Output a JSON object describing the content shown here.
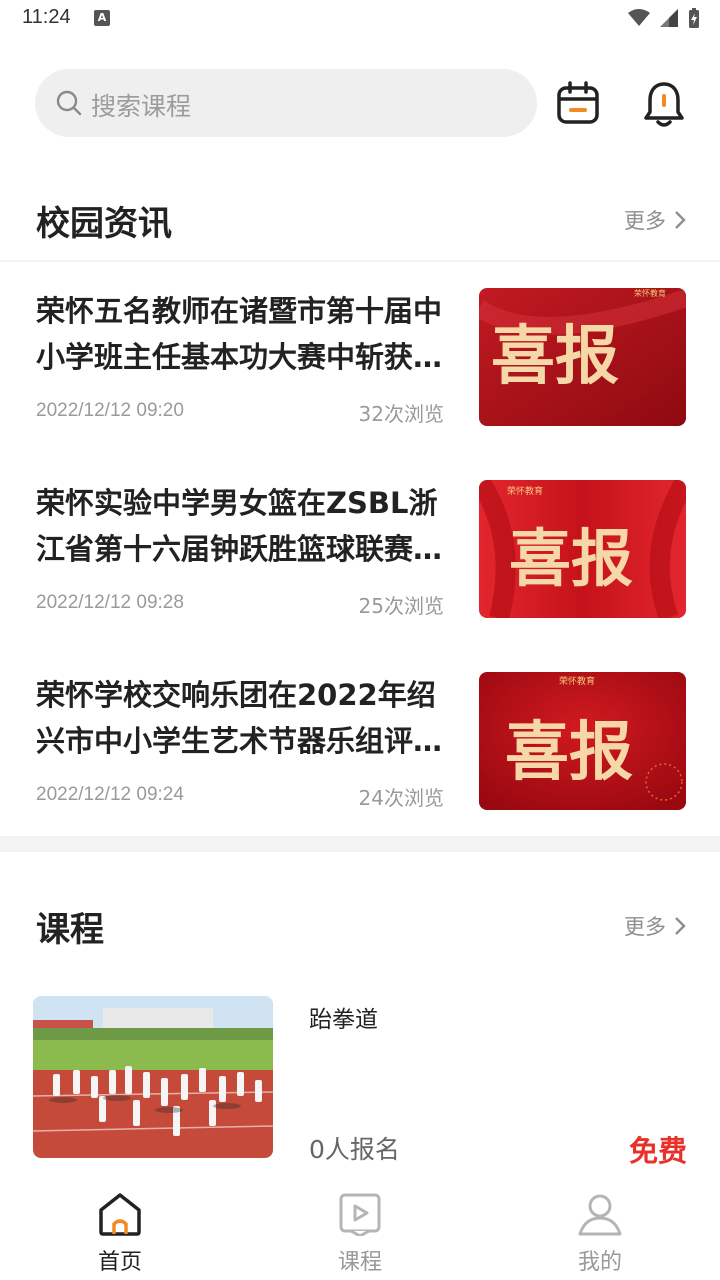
{
  "status": {
    "time": "11:24",
    "notif_glyph": "A"
  },
  "header": {
    "search_placeholder": "搜索课程"
  },
  "news_section": {
    "title": "校园资讯",
    "more": "更多",
    "items": [
      {
        "title": "荣怀五名教师在诸暨市第十届中小学班主任基本功大赛中斩获…",
        "date": "2022/12/12 09:20",
        "views": "32次浏览",
        "thumb_text": "喜报"
      },
      {
        "title": "荣怀实验中学男女篮在ZSBL浙江省第十六届钟跃胜篮球联赛…",
        "date": "2022/12/12 09:28",
        "views": "25次浏览",
        "thumb_text": "喜报"
      },
      {
        "title": "荣怀学校交响乐团在2022年绍兴市中小学生艺术节器乐组评…",
        "date": "2022/12/12 09:24",
        "views": "24次浏览",
        "thumb_text": "喜报"
      }
    ]
  },
  "course_section": {
    "title": "课程",
    "more": "更多",
    "items": [
      {
        "name": "跆拳道",
        "enroll": "0人报名",
        "price": "免费"
      }
    ]
  },
  "tabbar": {
    "items": [
      {
        "label": "首页",
        "active": true,
        "icon": "home-icon"
      },
      {
        "label": "课程",
        "active": false,
        "icon": "video-icon"
      },
      {
        "label": "我的",
        "active": false,
        "icon": "profile-icon"
      }
    ]
  },
  "colors": {
    "accent": "#f08a24",
    "price": "#e8312a",
    "red_banner": "#b50d15"
  }
}
